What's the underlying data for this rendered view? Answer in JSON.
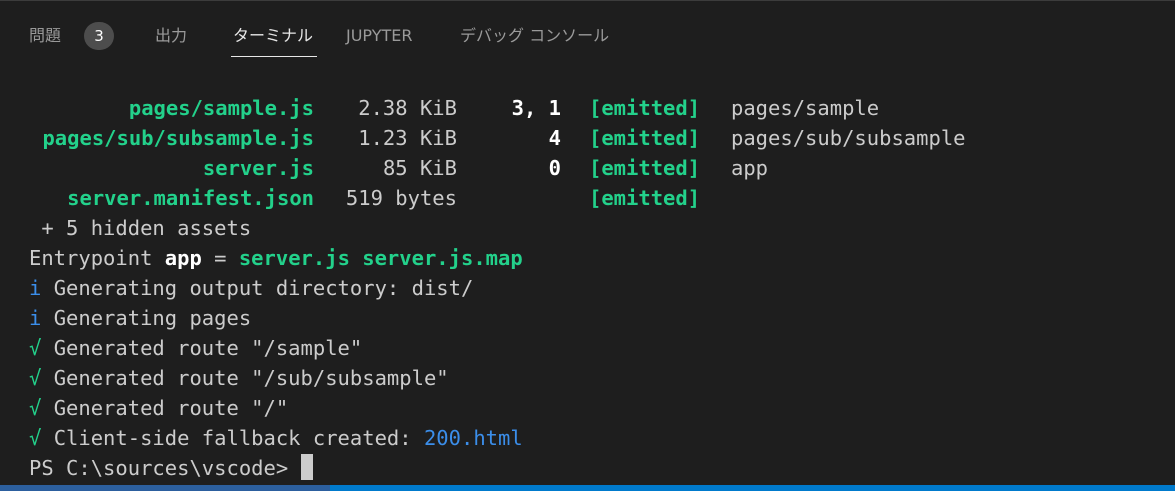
{
  "tabs": [
    {
      "label": "問題",
      "badge": "3"
    },
    {
      "label": "出力"
    },
    {
      "label": "ターミナル",
      "active": true
    },
    {
      "label": "JUPYTER"
    },
    {
      "label": "デバッグ コンソール"
    }
  ],
  "assets": [
    {
      "name": "pages/sample.js",
      "size": "2.38 KiB",
      "chunks": "3, 1",
      "status": "[emitted]",
      "chunk_names": "pages/sample"
    },
    {
      "name": "pages/sub/subsample.js",
      "size": "1.23 KiB",
      "chunks": "4",
      "status": "[emitted]",
      "chunk_names": "pages/sub/subsample"
    },
    {
      "name": "server.js",
      "size": "85 KiB",
      "chunks": "0",
      "status": "[emitted]",
      "chunk_names": "app"
    },
    {
      "name": "server.manifest.json",
      "size": "519 bytes",
      "chunks": "",
      "status": "[emitted]",
      "chunk_names": ""
    }
  ],
  "hidden_assets": " + 5 hidden assets",
  "entrypoint": {
    "prefix": "Entrypoint ",
    "name": "app",
    "equals": " = ",
    "files": "server.js server.js.map"
  },
  "messages": [
    {
      "icon": "i",
      "text": "Generating output directory: dist/"
    },
    {
      "icon": "i",
      "text": "Generating pages"
    },
    {
      "icon": "√",
      "text": "Generated route \"/sample\""
    },
    {
      "icon": "√",
      "text": "Generated route \"/sub/subsample\""
    },
    {
      "icon": "√",
      "text": "Generated route \"/\""
    },
    {
      "icon": "√",
      "text": "Client-side fallback created: ",
      "link": "200.html"
    }
  ],
  "prompt": "PS C:\\sources\\vscode>",
  "colors": {
    "background": "#1e1e1e",
    "green": "#23d18b",
    "blue": "#3b8eea",
    "text": "#cccccc",
    "statusbar": "#007acc"
  }
}
